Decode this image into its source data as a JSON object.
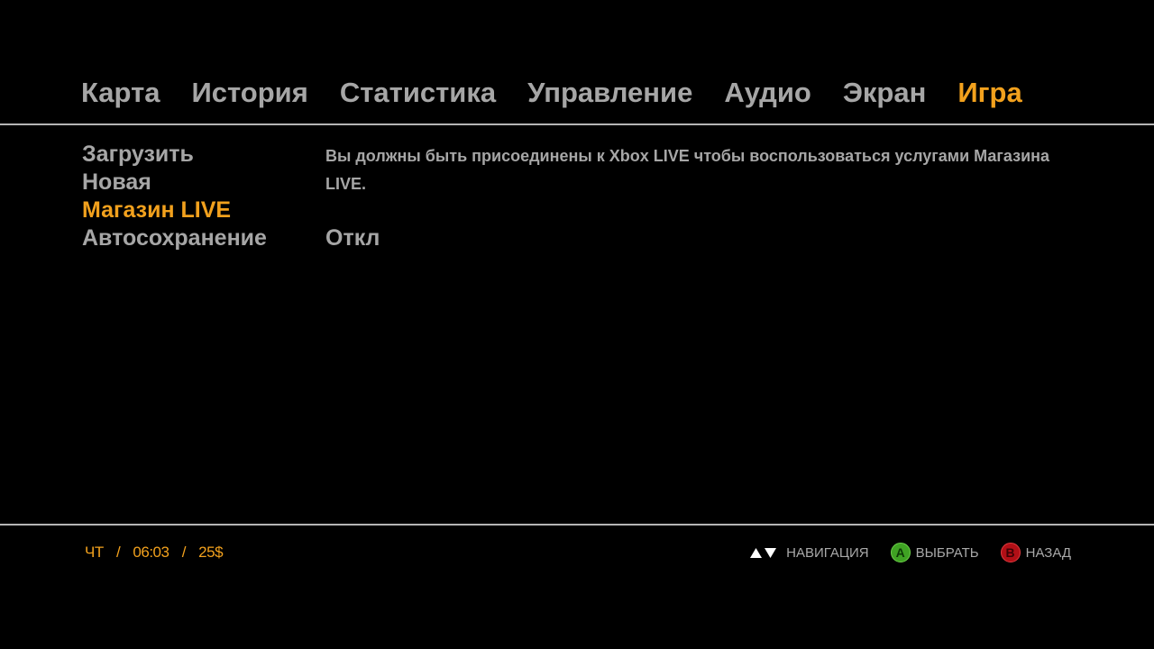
{
  "tabs": [
    {
      "label": "Карта"
    },
    {
      "label": "История"
    },
    {
      "label": "Статистика"
    },
    {
      "label": "Управление"
    },
    {
      "label": "Аудио"
    },
    {
      "label": "Экран"
    },
    {
      "label": "Игра",
      "active": true
    }
  ],
  "menu": {
    "items": [
      {
        "label": "Загрузить"
      },
      {
        "label": "Новая"
      },
      {
        "label": "Магазин LIVE",
        "selected": true
      },
      {
        "label": "Автосохранение"
      }
    ]
  },
  "description": "Вы должны быть присоединены к Xbox LIVE чтобы воспользоваться услугами Магазина LIVE.",
  "autosave_value": "Откл",
  "status": {
    "day": "ЧТ",
    "separator": "/",
    "time": "06:03",
    "money": "25$"
  },
  "hints": {
    "navigate": {
      "label": "НАВИГАЦИЯ",
      "icons": [
        "arrow-up-icon",
        "arrow-down-icon"
      ]
    },
    "select": {
      "label": "ВЫБРАТЬ",
      "button": "A"
    },
    "back": {
      "label": "НАЗАД",
      "button": "B"
    }
  },
  "colors": {
    "background": "#000000",
    "text": "#a6a6a6",
    "accent": "#f2a11d",
    "rule": "#b5b5b5",
    "button_a": "#3fa223",
    "button_b": "#b10f16"
  }
}
